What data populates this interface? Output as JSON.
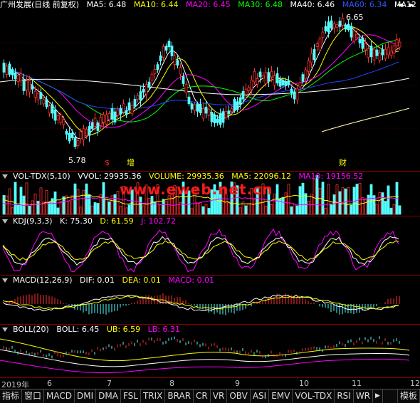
{
  "main": {
    "title": "广州发展(日线 前复权)",
    "ma": [
      {
        "label": "MA5: 6.48",
        "color": "#ffffff"
      },
      {
        "label": "MA10: 6.44",
        "color": "#ffff00"
      },
      {
        "label": "MA20: 6.45",
        "color": "#ff00ff"
      },
      {
        "label": "MA30: 6.48",
        "color": "#00ff00"
      },
      {
        "label": "MA40: 6.46",
        "color": "#ffffff"
      },
      {
        "label": "MA60: 6.34",
        "color": "#0000ff"
      },
      {
        "label": "MA12",
        "color": "#ffffff"
      }
    ],
    "high_label": "6.65",
    "low_label": "5.78",
    "markers": {
      "m1": "$",
      "m2": "增",
      "m3": "财"
    }
  },
  "vol": {
    "title": "VOL-TDX(5,10)",
    "vvol": "VVOL: 29935.36",
    "volume": "VOLUME: 29935.36",
    "ma5": "MA5: 22096.12",
    "ma10": "MA10: 19156.52"
  },
  "watermark": "www.eweb.net.cn",
  "kdj": {
    "title": "KDJ(9,3,3)",
    "k": "K: 75.30",
    "d": "D: 61.59",
    "j": "J: 102.72"
  },
  "macd": {
    "title": "MACD(12,26,9)",
    "dif": "DIF: 0.01",
    "dea": "DEA: 0.01",
    "macd": "MACD: 0.01"
  },
  "boll": {
    "title": "BOLL(20)",
    "boll": "BOLL: 6.45",
    "ub": "UB: 6.59",
    "lb": "LB: 6.31"
  },
  "dates": {
    "d1": "2019年",
    "d2": "6",
    "d3": "7",
    "d4": "8",
    "d5": "9",
    "d6": "10",
    "d7": "11",
    "d8": "12"
  },
  "tabs": [
    "指标",
    "窗口",
    "MACD",
    "DMI",
    "DMA",
    "FSL",
    "TRIX",
    "BRAR",
    "CR",
    "VR",
    "OBV",
    "ASI",
    "EMV",
    "VOL-TDX",
    "RSI",
    "WR"
  ],
  "right_tab": "模板"
}
